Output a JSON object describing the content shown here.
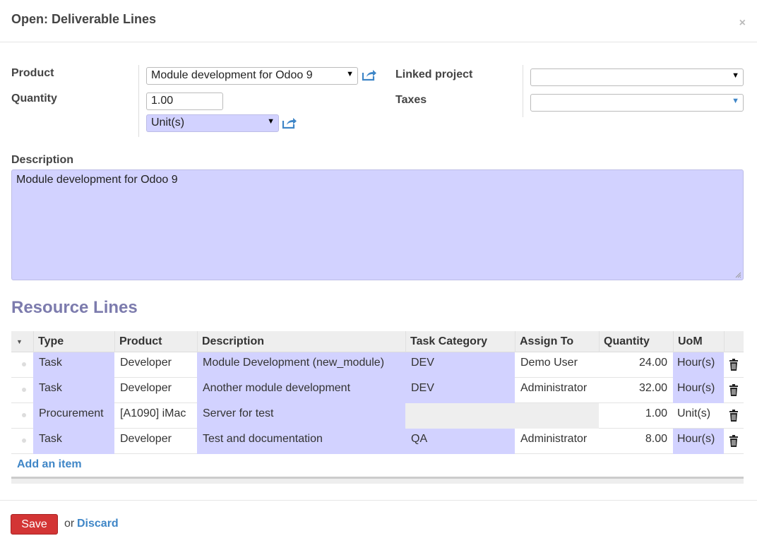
{
  "dialog": {
    "title": "Open: Deliverable Lines",
    "close_label": "×"
  },
  "form": {
    "product_label": "Product",
    "product_value": "Module development for Odoo 9",
    "quantity_label": "Quantity",
    "quantity_value": "1.00",
    "uom_value": "Unit(s)",
    "linked_project_label": "Linked project",
    "linked_project_value": "",
    "taxes_label": "Taxes",
    "taxes_value": "",
    "description_label": "Description",
    "description_value": "Module development for Odoo 9"
  },
  "resource_lines": {
    "title": "Resource Lines",
    "columns": [
      "Type",
      "Product",
      "Description",
      "Task Category",
      "Assign To",
      "Quantity",
      "UoM"
    ],
    "rows": [
      {
        "type": "Task",
        "product": "Developer",
        "description": "Module Development (new_module)",
        "task_category": "DEV",
        "assign_to": "Demo User",
        "quantity": "24.00",
        "uom": "Hour(s)"
      },
      {
        "type": "Task",
        "product": "Developer",
        "description": "Another module development",
        "task_category": "DEV",
        "assign_to": "Administrator",
        "quantity": "32.00",
        "uom": "Hour(s)"
      },
      {
        "type": "Procurement",
        "product": "[A1090] iMac",
        "description": "Server for test",
        "task_category": "",
        "assign_to": "",
        "quantity": "1.00",
        "uom": "Unit(s)"
      },
      {
        "type": "Task",
        "product": "Developer",
        "description": "Test and documentation",
        "task_category": "QA",
        "assign_to": "Administrator",
        "quantity": "8.00",
        "uom": "Hour(s)"
      }
    ],
    "add_item_label": "Add an item"
  },
  "footer": {
    "save_label": "Save",
    "or_label": "or",
    "discard_label": "Discard"
  },
  "colors": {
    "required_field": "#d2d2ff",
    "link": "#3f86c7",
    "save_button": "#d33535",
    "section_title": "#7c7bad"
  },
  "icons": {
    "external_link": "external-link-icon",
    "trash": "trash-icon",
    "dropdown": "caret-down-icon"
  }
}
